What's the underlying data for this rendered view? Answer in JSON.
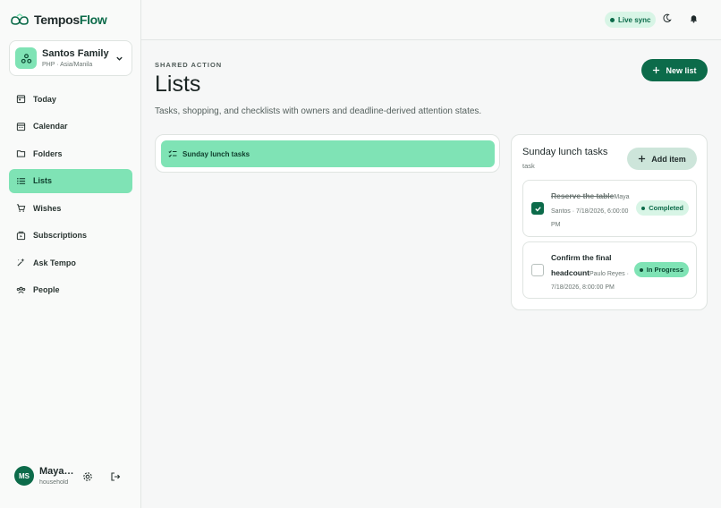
{
  "app": {
    "name_part1": "Tempos",
    "name_part2": "Flow"
  },
  "household": {
    "name": "Santos Family",
    "meta": "PHP · Asia/Manila"
  },
  "sidebar": {
    "items": [
      {
        "label": "Today",
        "icon": "calendar-today-icon"
      },
      {
        "label": "Calendar",
        "icon": "calendar-icon"
      },
      {
        "label": "Folders",
        "icon": "folder-icon"
      },
      {
        "label": "Lists",
        "icon": "list-icon",
        "active": true
      },
      {
        "label": "Wishes",
        "icon": "cart-icon"
      },
      {
        "label": "Subscriptions",
        "icon": "subscription-icon"
      },
      {
        "label": "Ask Tempo",
        "icon": "sparkle-icon"
      },
      {
        "label": "People",
        "icon": "people-icon"
      }
    ]
  },
  "user": {
    "initials": "MS",
    "name": "Maya Santos",
    "role": "household"
  },
  "topbar": {
    "live_label": "Live sync"
  },
  "page": {
    "eyebrow": "SHARED ACTION",
    "title": "Lists",
    "subtitle": "Tasks, shopping, and checklists with owners and deadline-derived attention states.",
    "new_button": "New list"
  },
  "lists": [
    {
      "label": "Sunday lunch tasks"
    }
  ],
  "detail": {
    "title": "Sunday lunch tasks",
    "kind": "task",
    "add_button": "Add item",
    "items": [
      {
        "title": "Reserve the table",
        "meta": "Maya Santos · 7/18/2026, 6:00:00 PM",
        "status": "Completed",
        "done": true
      },
      {
        "title": "Confirm the final headcount",
        "meta": "Paulo Reyes · 7/18/2026, 8:00:00 PM",
        "status": "In Progress",
        "done": false
      }
    ]
  },
  "colors": {
    "brand": "#0c6b4a",
    "accent": "#7fe3b5",
    "badge_light": "#d8f5e6"
  }
}
